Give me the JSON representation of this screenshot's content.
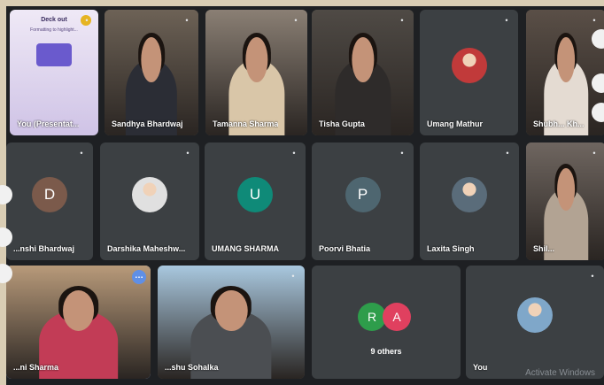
{
  "row1": [
    {
      "id": "you-presenting",
      "name": "You (Presentat...",
      "type": "presentation",
      "slide_title": "Deck out",
      "slide_sub": "Formatting to highlight...",
      "colors": {
        "bg": "#ded7e8"
      }
    },
    {
      "id": "sandhya",
      "name": "Sandhya Bhardwaj",
      "type": "camera",
      "colors": {
        "bg": "#6d6256",
        "shirt": "#2b2d35"
      }
    },
    {
      "id": "tamanna",
      "name": "Tamanna Sharma",
      "type": "camera",
      "colors": {
        "bg": "#8a7f74",
        "shirt": "#d9c6a8"
      }
    },
    {
      "id": "tisha",
      "name": "Tisha Gupta",
      "type": "camera",
      "colors": {
        "bg": "#4f4a45",
        "shirt": "#2e2b2a"
      }
    },
    {
      "id": "umang-mathur",
      "name": "Umang Mathur",
      "type": "photo",
      "colors": {
        "bg": "#3c4043",
        "avatar": "#c13a3a"
      }
    },
    {
      "id": "shubh",
      "name": "Shubh... Kh...",
      "type": "camera",
      "colors": {
        "bg": "#5a4f47",
        "shirt": "#e4dbd2"
      }
    }
  ],
  "row2": [
    {
      "id": "bhardwaj",
      "name": "...nshi Bhardwaj",
      "type": "letter",
      "letter": "D",
      "colors": {
        "avatar": "#7b5a4b"
      }
    },
    {
      "id": "darshika",
      "name": "Darshika Maheshw...",
      "type": "photo",
      "colors": {
        "avatar": "#e0e0e0"
      }
    },
    {
      "id": "umang-sharma",
      "name": "UMANG SHARMA",
      "type": "letter",
      "letter": "U",
      "colors": {
        "avatar": "#0f8a78"
      }
    },
    {
      "id": "poorvi",
      "name": "Poorvi Bhatia",
      "type": "letter",
      "letter": "P",
      "colors": {
        "avatar": "#4e6670"
      }
    },
    {
      "id": "laxita",
      "name": "Laxita Singh",
      "type": "photo",
      "colors": {
        "avatar": "#5a6c7a"
      }
    },
    {
      "id": "shil",
      "name": "Shil...",
      "type": "camera",
      "colors": {
        "bg": "#6f6660",
        "shirt": "#b2a393"
      }
    }
  ],
  "row3": [
    {
      "id": "teacher",
      "name": "...ni Sharma",
      "type": "camera",
      "active": true,
      "colors": {
        "bg": "#b89a7a",
        "shirt": "#c23c56"
      }
    },
    {
      "id": "sohalka",
      "name": "...shu Sohalka",
      "type": "camera",
      "colors": {
        "bg": "#a9c8df",
        "shirt": "#4b4e52"
      }
    },
    {
      "id": "others",
      "label": "9 others",
      "letters": [
        "R",
        "A"
      ],
      "colors": {
        "r": "#2e9d4b",
        "a": "#e0405f"
      }
    },
    {
      "id": "you",
      "name": "You",
      "type": "photo",
      "colors": {
        "avatar": "#7fa7c9"
      }
    }
  ],
  "watermark": "Activate Windows",
  "icons": {
    "mic_off": "mic-off-icon",
    "more": "more-options-icon"
  }
}
